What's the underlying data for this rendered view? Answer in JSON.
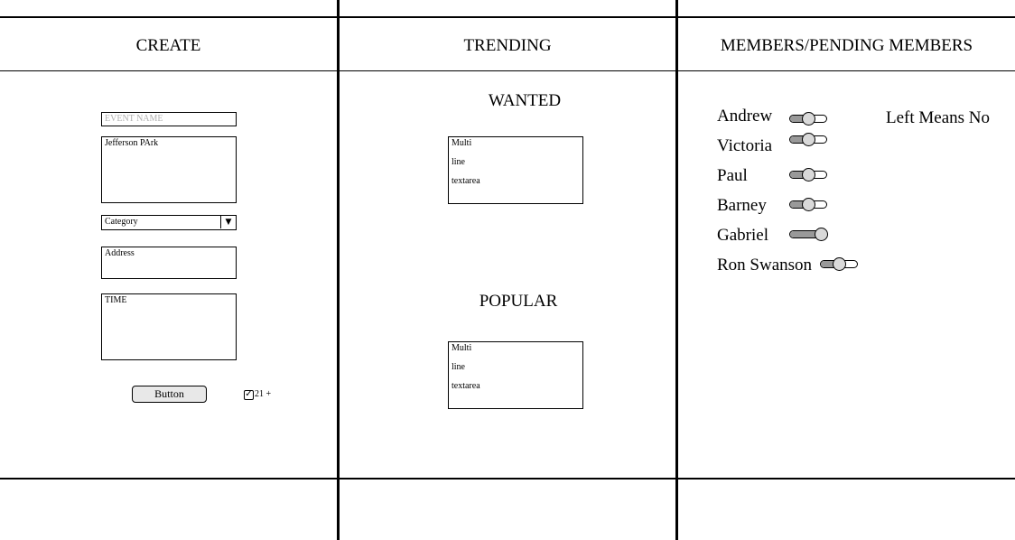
{
  "columns": {
    "create": "CREATE",
    "trending": "TRENDING",
    "members": "MEMBERS/PENDING MEMBERS"
  },
  "create": {
    "event_name_placeholder": "EVENT NAME",
    "description_value": "Jefferson PArk",
    "category_selected": "Category",
    "address_value": "Address",
    "time_value": "TIME",
    "button_label": "Button",
    "checkbox_label": "21 +",
    "checkbox_checked": true
  },
  "trending": {
    "wanted_title": "WANTED",
    "wanted_lines": [
      "Multi",
      "line",
      "textarea"
    ],
    "popular_title": "POPULAR",
    "popular_lines": [
      "Multi",
      "line",
      "textarea"
    ]
  },
  "members": {
    "note": "Left Means No",
    "list": [
      {
        "name": "Andrew",
        "toggle": 0.5
      },
      {
        "name": "Victoria",
        "toggle": 0.5
      },
      {
        "name": "Paul",
        "toggle": 0.5
      },
      {
        "name": "Barney",
        "toggle": 0.5
      },
      {
        "name": "Gabriel",
        "toggle": 1.0
      },
      {
        "name": "Ron Swanson",
        "toggle": 0.5
      }
    ]
  },
  "icons": {
    "dropdown": "triangle-down-icon",
    "checkbox": "check-icon"
  }
}
